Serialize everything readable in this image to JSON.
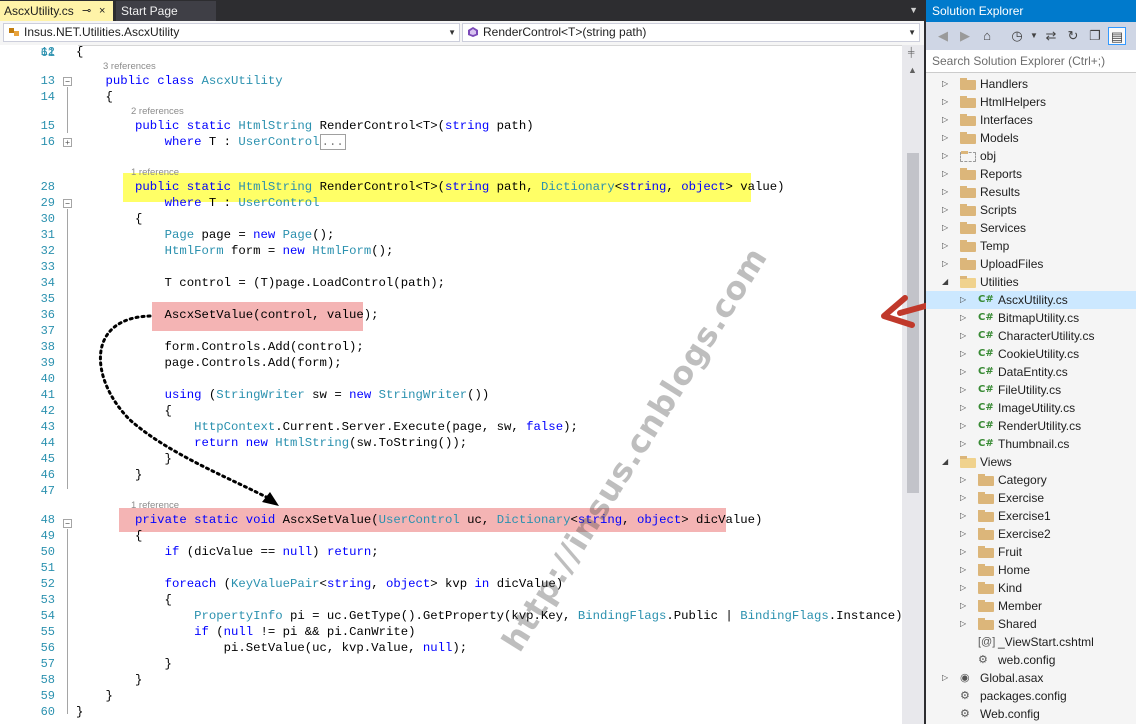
{
  "tabs": {
    "active": "AscxUtility.cs",
    "pin": "⊸",
    "close": "×",
    "inactive": "Start Page"
  },
  "nav": {
    "left": "Insus.NET.Utilities.AscxUtility",
    "right": "RenderControl<T>(string path)"
  },
  "code": {
    "refs": {
      "r13": "3 references",
      "r15": "2 references",
      "r29": "1 reference",
      "r49": "1 reference"
    },
    "collapsed_text": "...",
    "line_numbers": [
      "12",
      "13",
      "14",
      "15",
      "16",
      "28",
      "29",
      "30",
      "31",
      "32",
      "33",
      "34",
      "35",
      "36",
      "37",
      "38",
      "39",
      "40",
      "41",
      "42",
      "43",
      "44",
      "45",
      "46",
      "47",
      "48",
      "49",
      "50",
      "51",
      "52",
      "53",
      "54",
      "55",
      "56",
      "57",
      "58",
      "59",
      "60",
      "61"
    ]
  },
  "watermark": "http://insus.cnblogs.com",
  "solution_explorer": {
    "title": "Solution Explorer",
    "search_placeholder": "Search Solution Explorer (Ctrl+;)",
    "items": [
      {
        "label": "Handlers",
        "type": "folder"
      },
      {
        "label": "HtmlHelpers",
        "type": "folder"
      },
      {
        "label": "Interfaces",
        "type": "folder"
      },
      {
        "label": "Models",
        "type": "folder"
      },
      {
        "label": "obj",
        "type": "folder-dashed"
      },
      {
        "label": "Reports",
        "type": "folder"
      },
      {
        "label": "Results",
        "type": "folder"
      },
      {
        "label": "Scripts",
        "type": "folder"
      },
      {
        "label": "Services",
        "type": "folder"
      },
      {
        "label": "Temp",
        "type": "folder"
      },
      {
        "label": "UploadFiles",
        "type": "folder"
      },
      {
        "label": "Utilities",
        "type": "folder-open"
      },
      {
        "label": "AscxUtility.cs",
        "type": "cs"
      },
      {
        "label": "BitmapUtility.cs",
        "type": "cs"
      },
      {
        "label": "CharacterUtility.cs",
        "type": "cs"
      },
      {
        "label": "CookieUtility.cs",
        "type": "cs"
      },
      {
        "label": "DataEntity.cs",
        "type": "cs"
      },
      {
        "label": "FileUtility.cs",
        "type": "cs"
      },
      {
        "label": "ImageUtility.cs",
        "type": "cs"
      },
      {
        "label": "RenderUtility.cs",
        "type": "cs"
      },
      {
        "label": "Thumbnail.cs",
        "type": "cs"
      },
      {
        "label": "Views",
        "type": "folder-open"
      },
      {
        "label": "Category",
        "type": "folder"
      },
      {
        "label": "Exercise",
        "type": "folder"
      },
      {
        "label": "Exercise1",
        "type": "folder"
      },
      {
        "label": "Exercise2",
        "type": "folder"
      },
      {
        "label": "Fruit",
        "type": "folder"
      },
      {
        "label": "Home",
        "type": "folder"
      },
      {
        "label": "Kind",
        "type": "folder"
      },
      {
        "label": "Member",
        "type": "folder"
      },
      {
        "label": "Shared",
        "type": "folder"
      },
      {
        "label": "_ViewStart.cshtml",
        "type": "cshtml"
      },
      {
        "label": "web.config",
        "type": "config"
      },
      {
        "label": "Global.asax",
        "type": "asax"
      },
      {
        "label": "packages.config",
        "type": "config"
      },
      {
        "label": "Web.config",
        "type": "config"
      }
    ]
  }
}
